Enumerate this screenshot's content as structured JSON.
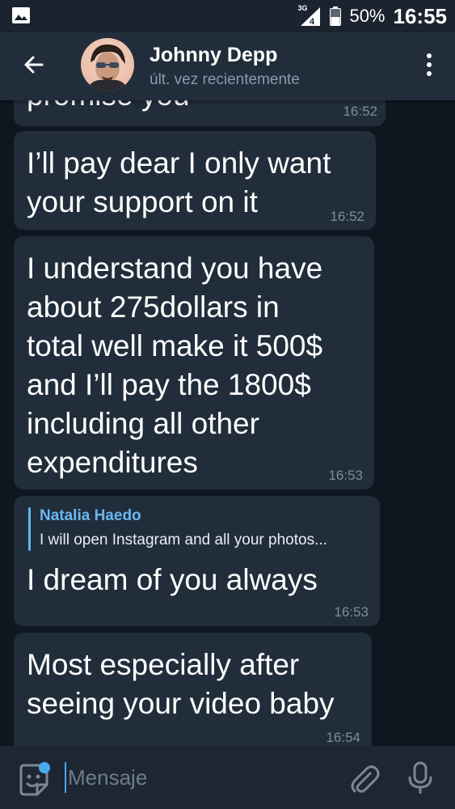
{
  "status_bar": {
    "network": "3G",
    "battery_percent": "50%",
    "time": "16:55",
    "left_icon": "image-icon"
  },
  "header": {
    "contact_name": "Johnny Depp",
    "contact_status": "últ. vez recientemente",
    "back_icon": "arrow-left-icon",
    "menu_icon": "more-vertical-icon"
  },
  "messages": [
    {
      "text": "promise you",
      "time": "16:52"
    },
    {
      "text": "I’ll pay dear I only want\nyour support on it",
      "time": "16:52"
    },
    {
      "text": "I understand you have\nabout 275dollars in\ntotal well make it 500$\nand I’ll pay the 1800$\nincluding all other\nexpenditures",
      "time": "16:53"
    },
    {
      "reply_to": {
        "name": "Natalia Haedo",
        "text": "I will open Instagram and all your photos..."
      },
      "text": "I dream of you always",
      "time": "16:53"
    },
    {
      "text": "Most especially after\nseeing your video baby",
      "time": "16:54"
    }
  ],
  "composer": {
    "placeholder": "Mensaje",
    "emoji_icon": "sticker-icon",
    "attach_icon": "paperclip-icon",
    "mic_icon": "microphone-icon"
  },
  "colors": {
    "accent": "#4aa8f0",
    "bubble": "#212d3b",
    "header": "#212d3b",
    "background": "#0e1620",
    "reply_name": "#6ab7f0"
  }
}
